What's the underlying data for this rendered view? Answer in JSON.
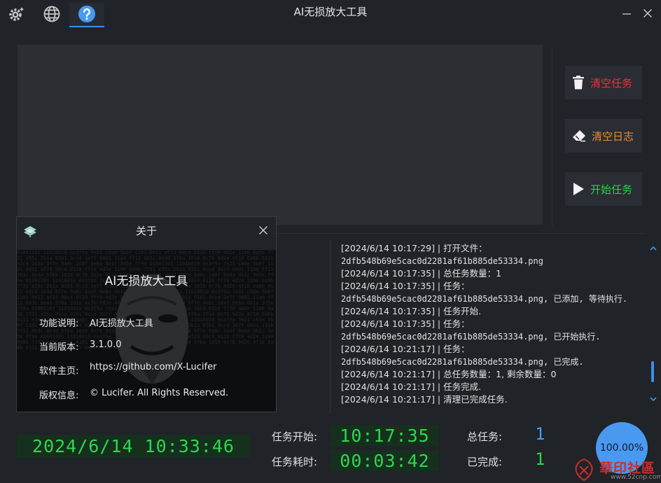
{
  "app": {
    "title": "AI无损放大工具",
    "accent": "#3d8fe6",
    "icons": [
      "settings-gear-icon",
      "globe-icon",
      "help-icon",
      "minimize-icon",
      "close-icon"
    ]
  },
  "actions": {
    "clear_tasks": {
      "label": "清空任务",
      "color": "#e8343a",
      "icon": "trash-icon"
    },
    "clear_log": {
      "label": "清空日志",
      "color": "#f08a2a",
      "icon": "eraser-icon"
    },
    "start_task": {
      "label": "开始任务",
      "color": "#33d04a",
      "icon": "play-icon"
    }
  },
  "log": [
    {
      "text": "[2024/6/14 10:17:29] | 打开文件：",
      "mono": false
    },
    {
      "text": "2dfb548b69e5cac0d2281af61b885de53334.png",
      "mono": true
    },
    {
      "text": "[2024/6/14 10:17:35] | 总任务数量：1",
      "mono": false
    },
    {
      "text": "[2024/6/14 10:17:35] | 任务：",
      "mono": false
    },
    {
      "text": "2dfb548b69e5cac0d2281af61b885de53334.png, 已添加, 等待执行.",
      "mono": true
    },
    {
      "text": "[2024/6/14 10:17:35] | 任务开始.",
      "mono": false
    },
    {
      "text": "[2024/6/14 10:17:35] | 任务：",
      "mono": false
    },
    {
      "text": "2dfb548b69e5cac0d2281af61b885de53334.png, 已开始执行.",
      "mono": true
    },
    {
      "text": "[2024/6/14 10:21:17] | 任务：",
      "mono": false
    },
    {
      "text": "2dfb548b69e5cac0d2281af61b885de53334.png, 已完成.",
      "mono": true
    },
    {
      "text": "[2024/6/14 10:21:17] | 总任务数量：1, 剩余数量：0",
      "mono": false
    },
    {
      "text": "[2024/6/14 10:21:17] | 任务完成.",
      "mono": false
    },
    {
      "text": "[2024/6/14 10:21:17] | 清理已完成任务.",
      "mono": false
    }
  ],
  "stats": {
    "clock": "2024/6/14 10:33:46",
    "task_start_label": "任务开始:",
    "task_start_value": "10:17:35",
    "task_elapsed_label": "任务耗时:",
    "task_elapsed_value": "00:03:42",
    "total_label": "总任务:",
    "total_value": "1",
    "done_label": "已完成:",
    "done_value": "1",
    "progress_text": "100.00%",
    "progress": 1.0
  },
  "about": {
    "title": "关于",
    "app_name": "AI无损放大工具",
    "fields": [
      {
        "key": "功能说明:",
        "value": "AI无损放大工具"
      },
      {
        "key": "当前版本:",
        "value": "3.1.0.0"
      },
      {
        "key": "软件主页:",
        "value": "https://github.com/X-Lucifer"
      },
      {
        "key": "版权信息:",
        "value": "© Lucifer. All Rights Reserved."
      }
    ]
  },
  "watermark": {
    "text": "華印社區",
    "url": "www.52cnp.com"
  }
}
